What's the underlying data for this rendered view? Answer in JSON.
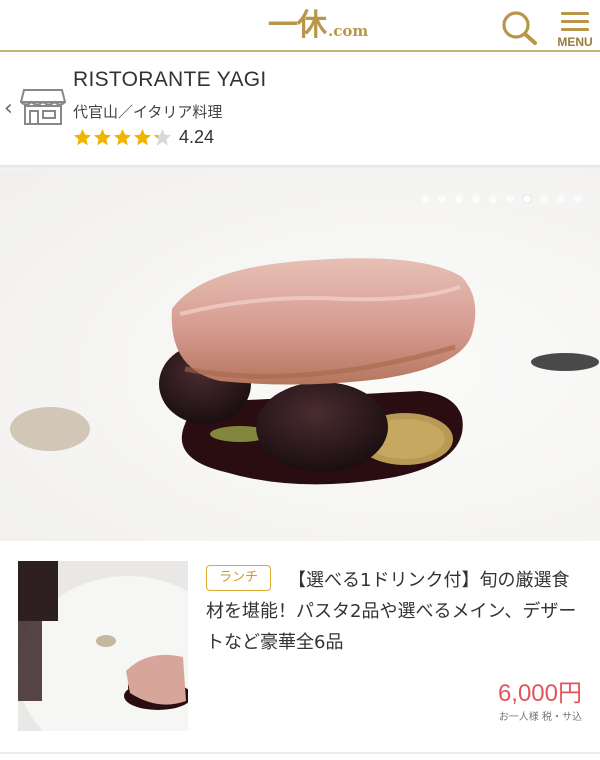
{
  "header": {
    "logo_mark": "一休",
    "logo_suffix": ".com",
    "search_icon": "search-icon",
    "menu_label": "MENU",
    "accent_color": "#b8964a"
  },
  "restaurant": {
    "store_icon": "store-icon",
    "name": "RISTORANTE YAGI",
    "category": "代官山／イタリア料理",
    "rating": "4.24",
    "rating_value": 4.24,
    "star_color": "#f0b400"
  },
  "gallery": {
    "slide_count": 10,
    "active_slide": 7
  },
  "course": {
    "badge": "ランチ",
    "title": "【選べる1ドリンク付】旬の厳選食材を堪能！パスタ2品や選べるメイン、デザートなど豪華全6品",
    "price": "6,000円",
    "price_note": "お一人様 税・サ込",
    "price_color": "#e2555f"
  }
}
